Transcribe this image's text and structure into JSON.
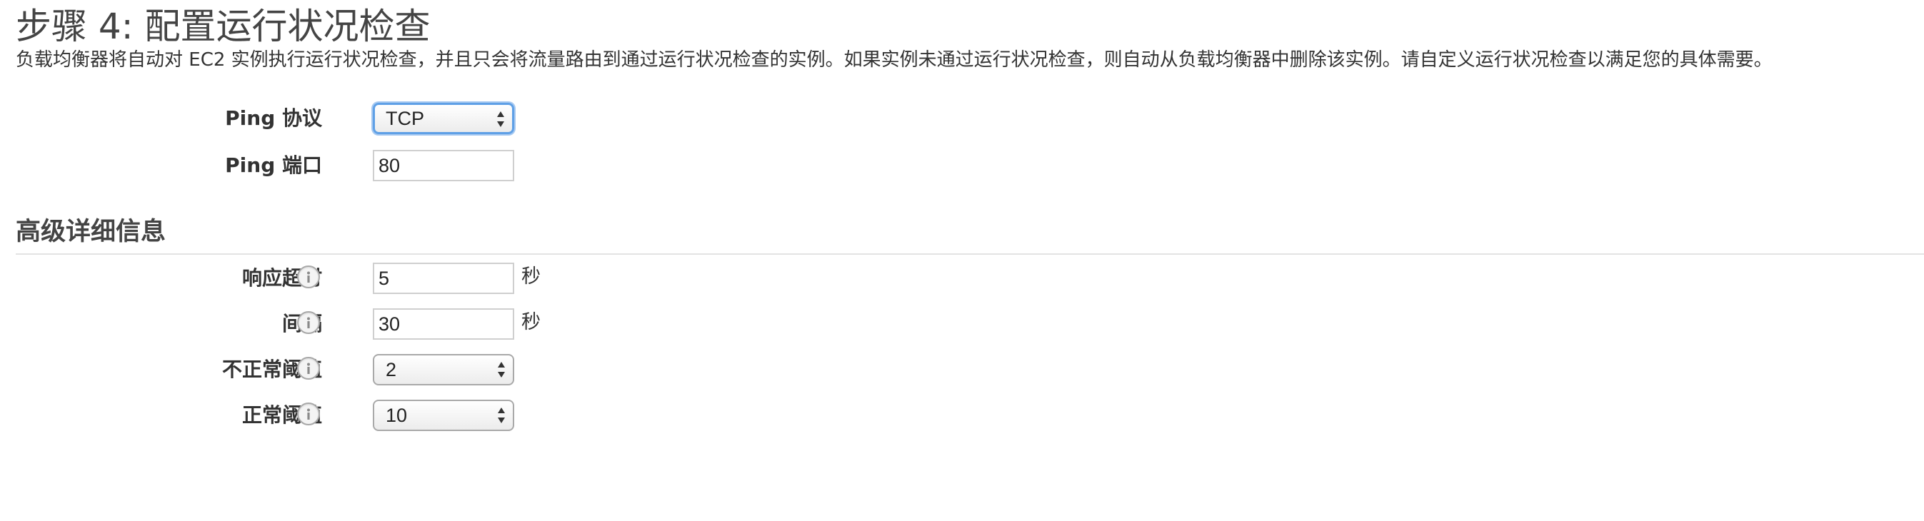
{
  "step": {
    "title": "步骤 4: 配置运行状况检查",
    "description": "负载均衡器将自动对 EC2 实例执行运行状况检查，并且只会将流量路由到通过运行状况检查的实例。如果实例未通过运行状况检查，则自动从负载均衡器中删除该实例。请自定义运行状况检查以满足您的具体需要。"
  },
  "ping": {
    "protocol_label": "Ping 协议",
    "protocol_value": "TCP",
    "port_label": "Ping 端口",
    "port_value": "80"
  },
  "advanced": {
    "section_title": "高级详细信息",
    "response_timeout": {
      "label": "响应超时",
      "value": "5",
      "unit": "秒",
      "icon": "info-icon"
    },
    "interval": {
      "label": "间隔",
      "value": "30",
      "unit": "秒",
      "icon": "info-icon"
    },
    "unhealthy_threshold": {
      "label": "不正常阈值",
      "value": "2",
      "icon": "info-icon"
    },
    "healthy_threshold": {
      "label": "正常阈值",
      "value": "10",
      "icon": "info-icon"
    }
  },
  "colors": {
    "focus_ring": "#5fa0e6",
    "text": "#333333",
    "divider": "#e3e3e3"
  }
}
